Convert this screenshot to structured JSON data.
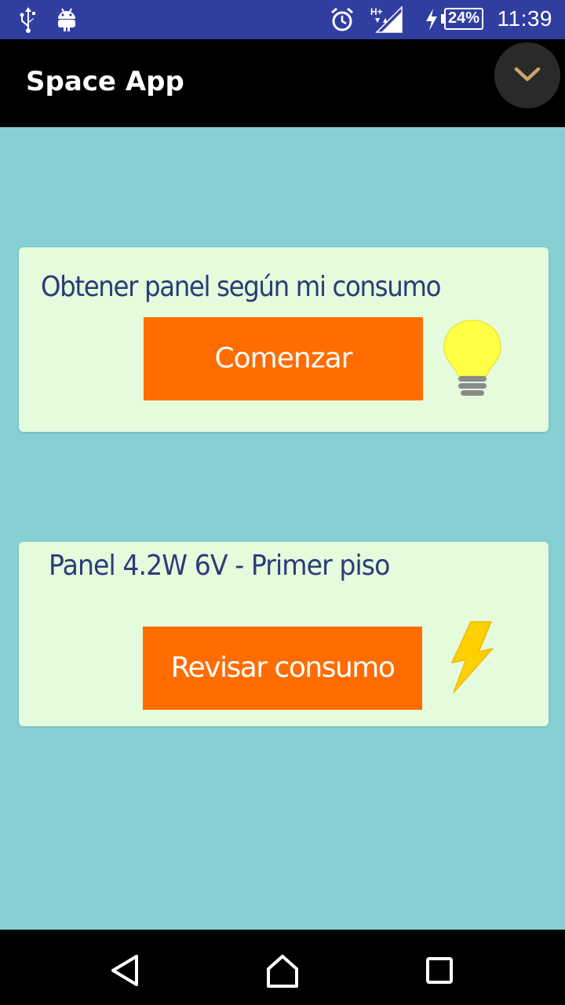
{
  "status_bar": {
    "time": "11:39",
    "battery_percent": "24%",
    "network_label": "H+",
    "icons": [
      "usb-icon",
      "android-icon",
      "alarm-icon",
      "signal-icon",
      "charging-icon",
      "battery-icon"
    ]
  },
  "app_bar": {
    "title": "Space App",
    "overflow_icon": "chevron-down-icon"
  },
  "cards": [
    {
      "title": "Obtener panel según mi consumo",
      "button_label": "Comenzar",
      "icon": "lightbulb-icon"
    },
    {
      "title": "Panel 4.2W 6V - Primer piso",
      "button_label": "Revisar consumo",
      "icon": "lightning-icon"
    }
  ],
  "nav_bar": {
    "icons": [
      "back-icon",
      "home-icon",
      "recents-icon"
    ]
  },
  "colors": {
    "status_bar": "#303f9f",
    "app_bar": "#000000",
    "background": "#86d0d4",
    "card": "#e4fbdc",
    "button": "#ff6d00",
    "card_text": "#2e3a78"
  }
}
